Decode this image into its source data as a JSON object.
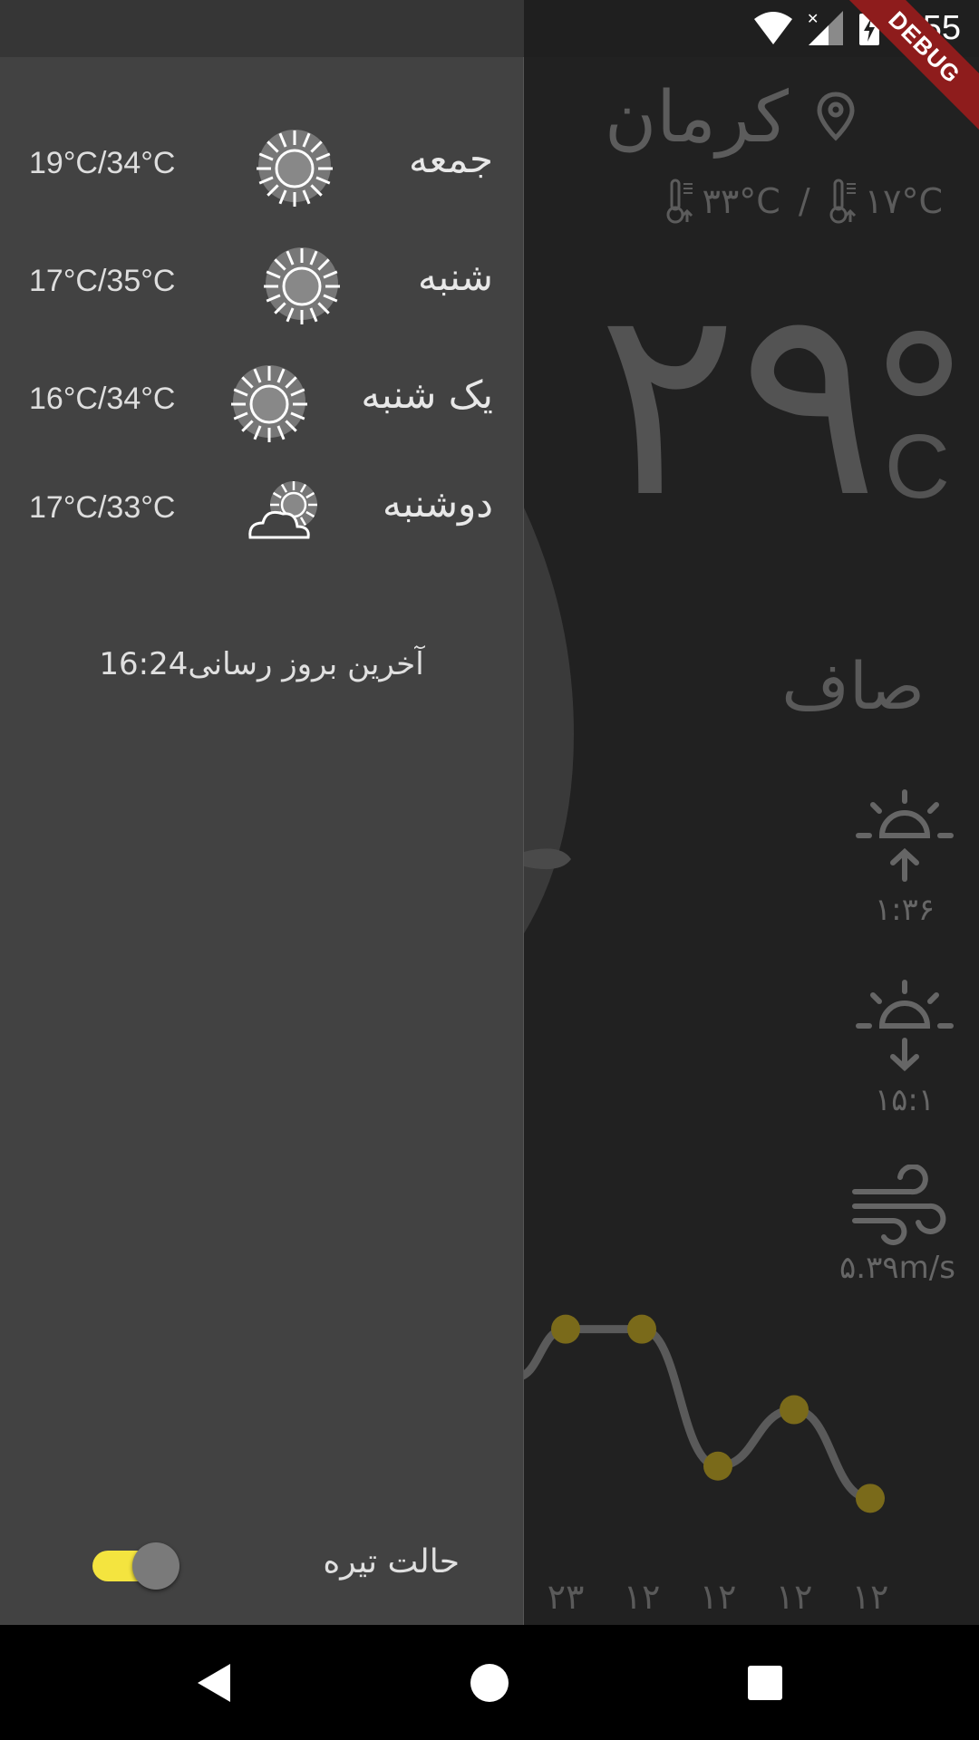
{
  "status_bar": {
    "time": "8:55",
    "debug_label": "DEBUG",
    "icons": [
      "wifi-icon",
      "signal-icon",
      "battery-charging-icon"
    ]
  },
  "main": {
    "city": "کرمان",
    "max_temp": "۳۳°C",
    "separator": "/",
    "min_temp": "۱۷°C",
    "current_temp": "۲۹",
    "unit": "C",
    "condition": "صاف",
    "sunrise": "۱:۳۶",
    "sunset": "۱۵:۱",
    "wind": "۵.۳۹m/s"
  },
  "drawer": {
    "forecast": [
      {
        "day": "جمعه",
        "range": "19°C/34°C",
        "icon": "sun-icon"
      },
      {
        "day": "شنبه",
        "range": "17°C/35°C",
        "icon": "sun-icon"
      },
      {
        "day": "یک شنبه",
        "range": "16°C/34°C",
        "icon": "sun-icon"
      },
      {
        "day": "دوشنبه",
        "range": "17°C/33°C",
        "icon": "partly-cloudy-icon"
      }
    ],
    "last_update": "آخرین بروز رسانی16:24",
    "dark_mode_label": "حالت تیره",
    "dark_mode_on": true
  },
  "chart_data": {
    "type": "line",
    "categories": [
      "۲۳",
      "۱۲",
      "۱۲",
      "۱۲",
      "۱۲"
    ],
    "series": [
      {
        "values": [
          34,
          34,
          17,
          24,
          13
        ]
      }
    ],
    "point_color": "#7a6a1a",
    "line_color": "#5a5a5a"
  },
  "colors": {
    "accent": "#f4e43f",
    "drawer_bg": "#424242",
    "screen_bg": "#212121",
    "debug": "#8e1c1c"
  }
}
